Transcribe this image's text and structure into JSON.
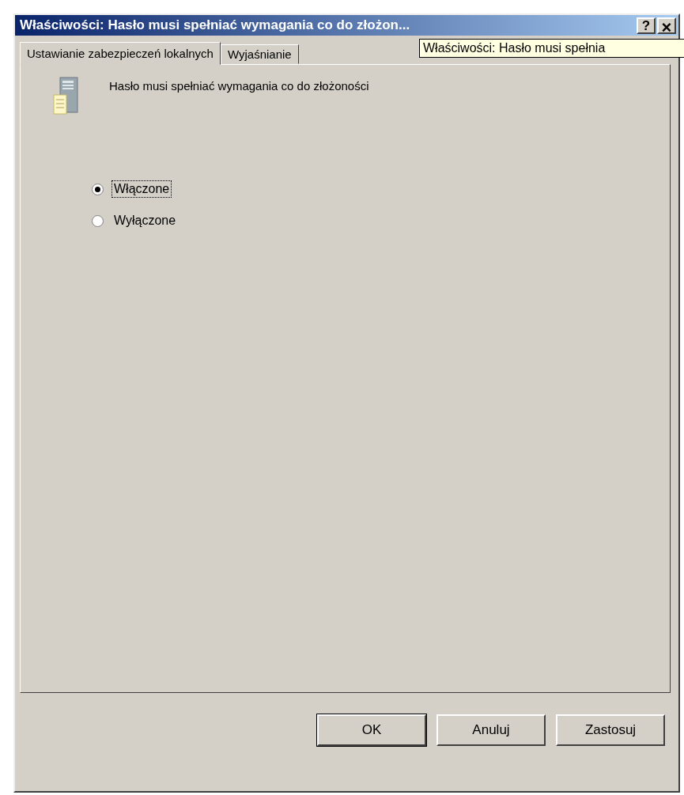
{
  "window": {
    "title": "Właściwości: Hasło musi spełniać wymagania co do złożon...",
    "help": "?",
    "close": "×"
  },
  "tabs": [
    {
      "label": "Ustawianie zabezpieczeń lokalnych",
      "selected": true
    },
    {
      "label": "Wyjaśnianie",
      "selected": false
    }
  ],
  "tooltip": "Właściwości: Hasło musi spełnia",
  "policy": {
    "name": "Hasło musi spełniać wymagania co do złożoności"
  },
  "options": [
    {
      "label": "Włączone",
      "selected": true,
      "focused": true
    },
    {
      "label": "Wyłączone",
      "selected": false,
      "focused": false
    }
  ],
  "buttons": [
    {
      "label": "OK",
      "default": true
    },
    {
      "label": "Anuluj",
      "default": false
    },
    {
      "label": "Zastosuj",
      "default": false
    }
  ]
}
